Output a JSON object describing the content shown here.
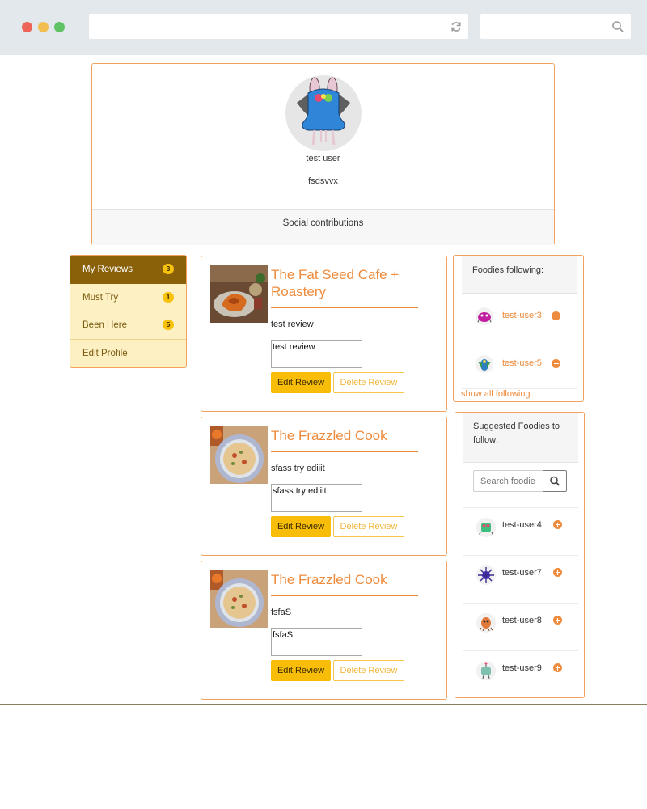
{
  "profile": {
    "username": "test user",
    "bio": "fsdsvvx",
    "footer": "Social contributions"
  },
  "nav": {
    "items": [
      {
        "label": "My Reviews",
        "count": "3",
        "active": true
      },
      {
        "label": "Must Try",
        "count": "1",
        "active": false
      },
      {
        "label": "Been Here",
        "count": "5",
        "active": false
      },
      {
        "label": "Edit Profile",
        "count": "",
        "active": false
      }
    ]
  },
  "reviews": [
    {
      "restaurant": "The Fat Seed Cafe + Roastery",
      "text": "test review",
      "input_value": "test review",
      "edit_label": "Edit Review",
      "delete_label": "Delete Review"
    },
    {
      "restaurant": "The Frazzled Cook",
      "text": "sfass try ediiit",
      "input_value": "sfass try ediiit",
      "edit_label": "Edit Review",
      "delete_label": "Delete Review"
    },
    {
      "restaurant": "The Frazzled Cook",
      "text": "fsfaS",
      "input_value": "fsfaS",
      "edit_label": "Edit Review",
      "delete_label": "Delete Review"
    }
  ],
  "following": {
    "title": "Foodies following:",
    "users": [
      "test-user3",
      "test-user5"
    ],
    "show_all": "show all following"
  },
  "suggested": {
    "title": "Suggested Foodies to follow:",
    "search_placeholder": "Search foodie",
    "users": [
      "test-user4",
      "test-user7",
      "test-user8",
      "test-user9"
    ]
  },
  "colors": {
    "accent": "#ee8b3c",
    "card_border": "#f2a25d",
    "nav_active": "#8a6109",
    "nav_bg": "#fdf0c2",
    "badge": "#f8c20c",
    "primary_button": "#f8bd08"
  },
  "icons": {
    "browser": [
      "reload-icon",
      "search-icon"
    ],
    "following_action": "minus-circle-icon",
    "suggested_action": "plus-circle-icon",
    "search_button": "search-icon"
  }
}
